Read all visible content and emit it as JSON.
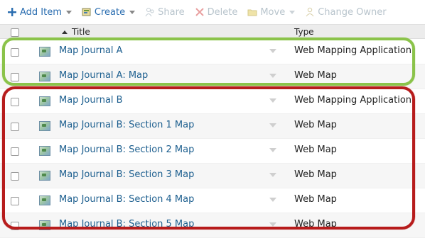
{
  "toolbar": {
    "add_item": "Add Item",
    "create": "Create",
    "share": "Share",
    "delete": "Delete",
    "move": "Move",
    "change_owner": "Change Owner"
  },
  "table": {
    "headers": {
      "title": "Title",
      "type": "Type"
    },
    "rows": [
      {
        "title": "Map Journal A",
        "type": "Web Mapping Application"
      },
      {
        "title": "Map Journal A: Map",
        "type": "Web Map"
      },
      {
        "title": "Map Journal B",
        "type": "Web Mapping Application"
      },
      {
        "title": "Map Journal B: Section 1 Map",
        "type": "Web Map"
      },
      {
        "title": "Map Journal B: Section 2 Map",
        "type": "Web Map"
      },
      {
        "title": "Map Journal B: Section 3 Map",
        "type": "Web Map"
      },
      {
        "title": "Map Journal B: Section 4 Map",
        "type": "Web Map"
      },
      {
        "title": "Map Journal B: Section 5 Map",
        "type": "Web Map"
      }
    ]
  },
  "annotations": {
    "group_a_color": "#8bc34a",
    "group_b_color": "#b71c1c"
  }
}
